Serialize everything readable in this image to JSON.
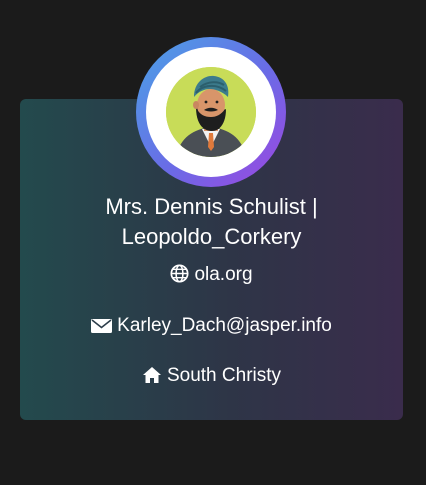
{
  "profile": {
    "name": "Mrs. Dennis Schulist |",
    "username": "Leopoldo_Corkery",
    "website": "ola.org",
    "email": "Karley_Dach@jasper.info",
    "city": "South Christy"
  },
  "icons": {
    "website": "globe-icon",
    "email": "envelope-icon",
    "city": "home-icon"
  },
  "colors": {
    "page_background": "#1b1b1b",
    "card_gradient": [
      "#234a4d",
      "#2e3547",
      "#3a2c4c"
    ],
    "avatar_ring_gradient": [
      "#4aa3e6",
      "#6a6be6",
      "#9f45e0"
    ],
    "avatar_background": "#c8dc58",
    "text": "#ffffff"
  }
}
